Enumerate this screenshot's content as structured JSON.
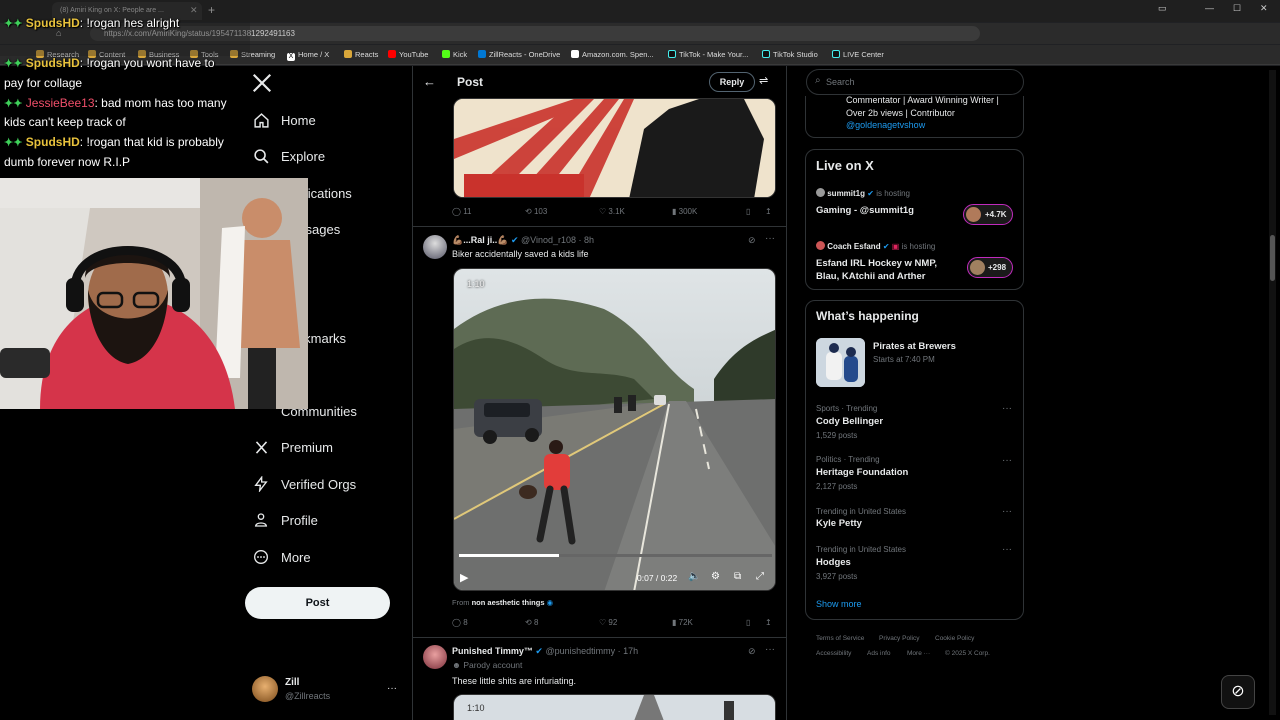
{
  "browser": {
    "tab1_title": "(8) Amiri King on X: People are ...",
    "url": "https://x.com/AmiriKing/status/1954711381292491163",
    "bookmarks": [
      "Research",
      "Content",
      "Business",
      "Tools",
      "Streaming",
      "Home / X",
      "Reacts",
      "YouTube",
      "Kick",
      "ZillReacts - OneDrive",
      "Amazon.com. Spen...",
      "TikTok - Make Your...",
      "TikTok Studio",
      "LIVE Center"
    ]
  },
  "nav": {
    "items": [
      "Home",
      "Explore",
      "Notifications",
      "Messages",
      "Bookmarks",
      "Communities",
      "Premium",
      "Verified Orgs",
      "Profile",
      "More"
    ],
    "post_label": "Post"
  },
  "account": {
    "name": "Zill",
    "handle": "@Zillreacts"
  },
  "header": {
    "title": "Post",
    "reply_label": "Reply"
  },
  "tweet0": {
    "replies": "11",
    "retweets": "103",
    "likes": "3.1K",
    "views": "300K"
  },
  "tweet1": {
    "name": "💪🏽...Ral ji..💪🏽",
    "handle": "@Vinod_r108",
    "time": "· 8h",
    "text": "Biker accidentally saved a kids life",
    "timestamp_overlay": "1:10",
    "time_display": "0:07 / 0:22",
    "progress": 0.32,
    "from_label": "From",
    "from_name": "non aesthetic things",
    "replies": "8",
    "retweets": "8",
    "likes": "92",
    "views": "72K"
  },
  "tweet2": {
    "name": "Punished Timmy™",
    "handle": "@punishedtimmy",
    "time": "· 17h",
    "parody": "Parody account",
    "text": "These little shits are infuriating.",
    "timestamp_overlay": "1:10"
  },
  "right": {
    "search_placeholder": "Search",
    "bio_line1": "Commentator | Award Winning Writer |",
    "bio_line2": "Over 2b views | Contributor",
    "bio_link": "@goldenagetvshow",
    "live_title": "Live on X",
    "live": [
      {
        "host": "summit1g",
        "is_hosting": "is hosting",
        "title": "Gaming - @summit1g",
        "count": "+4.7K"
      },
      {
        "host": "Coach Esfand",
        "is_hosting": "is hosting",
        "title_line1": "Esfand IRL Hockey w NMP,",
        "title_line2": "Blau, KAtchii and Arther",
        "count": "+298"
      }
    ],
    "happening_title": "What’s happening",
    "event": {
      "name": "Pirates at Brewers",
      "time": "Starts at 7:40 PM"
    },
    "trends": [
      {
        "meta": "Sports · Trending",
        "name": "Cody Bellinger",
        "posts": "1,529 posts"
      },
      {
        "meta": "Politics · Trending",
        "name": "Heritage Foundation",
        "posts": "2,127 posts"
      },
      {
        "meta": "Trending in United States",
        "name": "Kyle Petty",
        "posts": ""
      },
      {
        "meta": "Trending in United States",
        "name": "Hodges",
        "posts": "3,927 posts"
      }
    ],
    "show_more": "Show more",
    "footer": [
      "Terms of Service",
      "Privacy Policy",
      "Cookie Policy",
      "Accessibility",
      "Ads info",
      "More ···",
      "© 2025 X Corp."
    ]
  },
  "chat": [
    {
      "user": "SpudsHD",
      "msg": ": !rogan hes alright"
    },
    {
      "user": "SpudsHD",
      "msg": ": !rogan you wont have to"
    },
    {
      "user": "",
      "msg": "pay for collage"
    },
    {
      "user": "JessieBee13",
      "msg": ": bad mom has too many"
    },
    {
      "user": "",
      "msg": "kids can't keep track of"
    },
    {
      "user": "SpudsHD",
      "msg": ": !rogan that kid is probably"
    },
    {
      "user": "",
      "msg": "dumb forever now R.I.P"
    }
  ],
  "colors": {
    "accent": "#1d9bf0",
    "bg": "#000000",
    "border": "#2f3336",
    "muted": "#71767b"
  }
}
